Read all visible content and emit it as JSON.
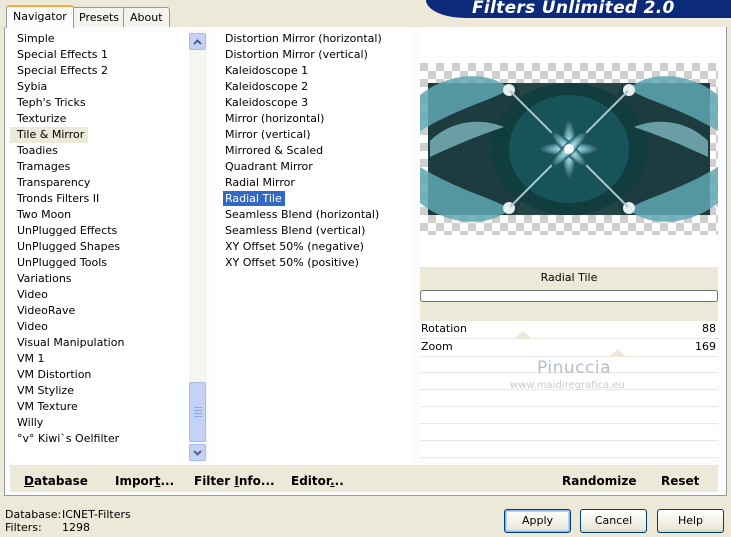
{
  "banner": {
    "title": "Filters Unlimited 2.0",
    "bg_color": "#0b2a7a"
  },
  "tabs": [
    {
      "label": "Navigator",
      "active": true
    },
    {
      "label": "Presets",
      "active": false
    },
    {
      "label": "About",
      "active": false
    }
  ],
  "categories": {
    "items": [
      "Simple",
      "Special Effects 1",
      "Special Effects 2",
      "Sybia",
      "Teph's Tricks",
      "Texturize",
      "Tile & Mirror",
      "Toadies",
      "Tramages",
      "Transparency",
      "Tronds Filters II",
      "Two Moon",
      "UnPlugged Effects",
      "UnPlugged Shapes",
      "UnPlugged Tools",
      "Variations",
      "Video",
      "VideoRave",
      "Video",
      "Visual Manipulation",
      "VM 1",
      "VM Distortion",
      "VM Stylize",
      "VM Texture",
      "Willy",
      "°v° Kiwi`s Oelfilter"
    ],
    "selected": "Tile & Mirror"
  },
  "filters": {
    "items": [
      "Distortion Mirror (horizontal)",
      "Distortion Mirror (vertical)",
      "Kaleidoscope 1",
      "Kaleidoscope 2",
      "Kaleidoscope 3",
      "Mirror (horizontal)",
      "Mirror (vertical)",
      "Mirrored & Scaled",
      "Quadrant Mirror",
      "Radial Mirror",
      "Radial Tile",
      "Seamless Blend (horizontal)",
      "Seamless Blend (vertical)",
      "XY Offset 50% (negative)",
      "XY Offset 50% (positive)"
    ],
    "selected": "Radial Tile",
    "selection_color": "#316ac5"
  },
  "preview": {
    "filter_name": "Radial Tile",
    "progress_fraction": 0,
    "dark_color": "#0f3a3c",
    "teal_color": "#4fa1ad",
    "checker_color": "#cfcfcf"
  },
  "params": [
    {
      "label": "Rotation",
      "value": "88",
      "slider_fraction": 0.345
    },
    {
      "label": "Zoom",
      "value": "169",
      "slider_fraction": 0.663
    }
  ],
  "watermark": {
    "line1": "Pinuccia",
    "line2": "www.maidiregrafica.eu"
  },
  "actions": {
    "database": "Database",
    "database_u": "D",
    "database_rest": "atabase",
    "import": "Import...",
    "import_pre": "Impor",
    "import_u": "t",
    "import_post": "...",
    "filter_info": "Filter Info...",
    "filter_info_pre": "Filter ",
    "filter_info_u": "I",
    "filter_info_post": "nfo...",
    "editor": "Editor...",
    "editor_pre": "Editor",
    "editor_u": ".",
    "editor_post": "..",
    "randomize": "Randomize",
    "reset": "Reset"
  },
  "status": {
    "database_label": "Database:",
    "database_value": "ICNET-Filters",
    "filters_label": "Filters:",
    "filters_value": "1298"
  },
  "buttons": {
    "apply": "Apply",
    "cancel": "Cancel",
    "help": "Help"
  }
}
